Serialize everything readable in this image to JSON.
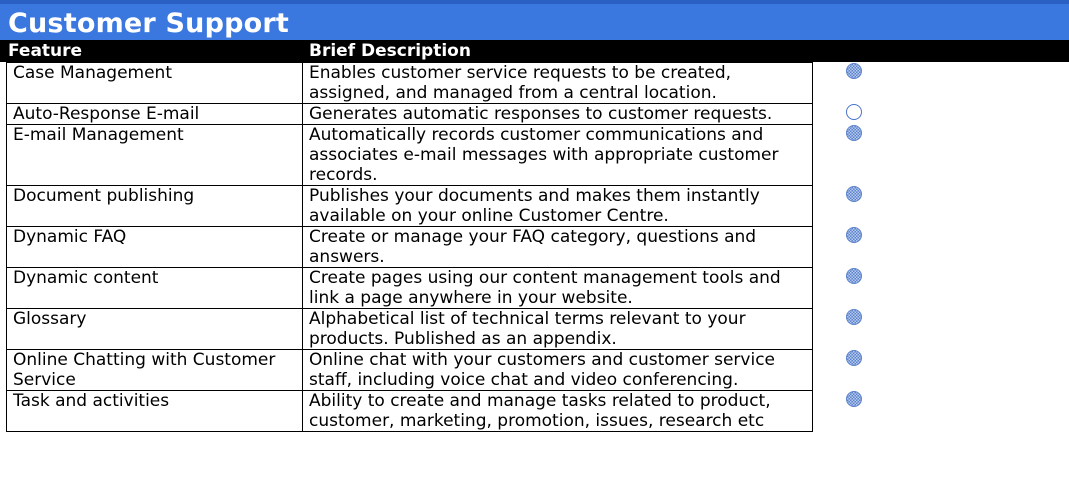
{
  "title": "Customer Support",
  "headers": {
    "feature": "Feature",
    "description": "Brief Description"
  },
  "rows": [
    {
      "feature": "Case Management",
      "description": "Enables customer service requests to be created, assigned, and managed from a central location.",
      "mark": "filled-circle-icon"
    },
    {
      "feature": "Auto-Response E-mail",
      "description": "Generates automatic responses to customer requests.",
      "mark": "empty-circle-icon"
    },
    {
      "feature": "E-mail Management",
      "description": "Automatically records customer communications and associates e-mail messages with appropriate customer records.",
      "mark": "filled-circle-icon"
    },
    {
      "feature": "Document publishing",
      "description": "Publishes your documents and makes them instantly available on your online Customer Centre.",
      "mark": "filled-circle-icon"
    },
    {
      "feature": "Dynamic FAQ",
      "description": "Create or manage your FAQ category, questions and answers.",
      "mark": "filled-circle-icon"
    },
    {
      "feature": "Dynamic content",
      "description": "Create pages using our content management tools and link a page anywhere in your website.",
      "mark": "filled-circle-icon"
    },
    {
      "feature": "Glossary",
      "description": "Alphabetical list of technical terms relevant to your products. Published as an appendix.",
      "mark": "filled-circle-icon"
    },
    {
      "feature": "Online Chatting with Customer Service",
      "description": "Online chat with your customers and customer service staff, including voice chat and video conferencing.",
      "mark": "filled-circle-icon"
    },
    {
      "feature": "Task and activities",
      "description": "Ability to create and manage tasks related to product, customer, marketing, promotion, issues, research etc",
      "mark": "filled-circle-icon"
    }
  ],
  "colors": {
    "title_bar": "#3a78e0",
    "header_bar": "#000000",
    "mark": "#5c82cc"
  }
}
